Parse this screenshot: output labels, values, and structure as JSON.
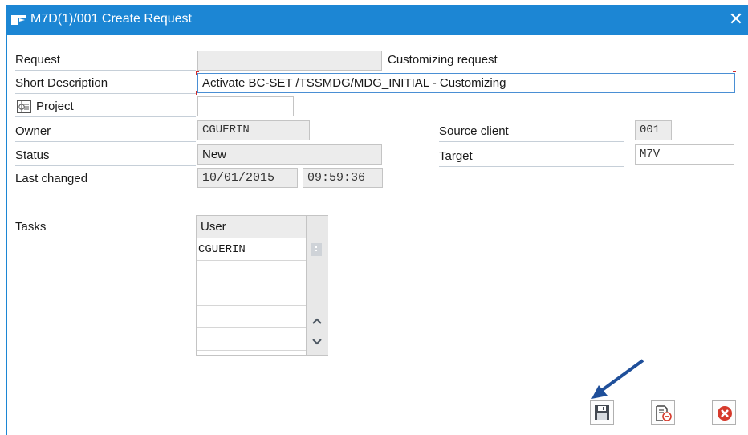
{
  "window": {
    "title": "M7D(1)/001 Create Request",
    "close_glyph": "✕"
  },
  "form": {
    "request_label": "Request",
    "request_value": "",
    "request_type": "Customizing request",
    "short_description_label": "Short Description",
    "short_description_value": "Activate BC-SET /TSSMDG/MDG_INITIAL - Customizing",
    "project_label": "Project",
    "project_value": "",
    "owner_label": "Owner",
    "owner_value": "CGUERIN",
    "status_label": "Status",
    "status_value": "New",
    "last_changed_label": "Last changed",
    "last_changed_date": "10/01/2015",
    "last_changed_time": "09:59:36",
    "source_client_label": "Source client",
    "source_client_value": "001",
    "target_label": "Target",
    "target_value": "M7V"
  },
  "tasks": {
    "label": "Tasks",
    "column_header": "User",
    "rows": [
      "CGUERIN",
      "",
      "",
      "",
      ""
    ]
  },
  "footer": {
    "buttons": [
      {
        "name": "save",
        "icon": "floppy-disk-icon"
      },
      {
        "name": "local-request",
        "icon": "document-minus-icon"
      },
      {
        "name": "cancel",
        "icon": "cancel-circle-icon"
      }
    ]
  },
  "colors": {
    "titlebar": "#1c86d4",
    "cancel_red": "#d63a2c",
    "arrow_blue": "#1f4f9a"
  }
}
